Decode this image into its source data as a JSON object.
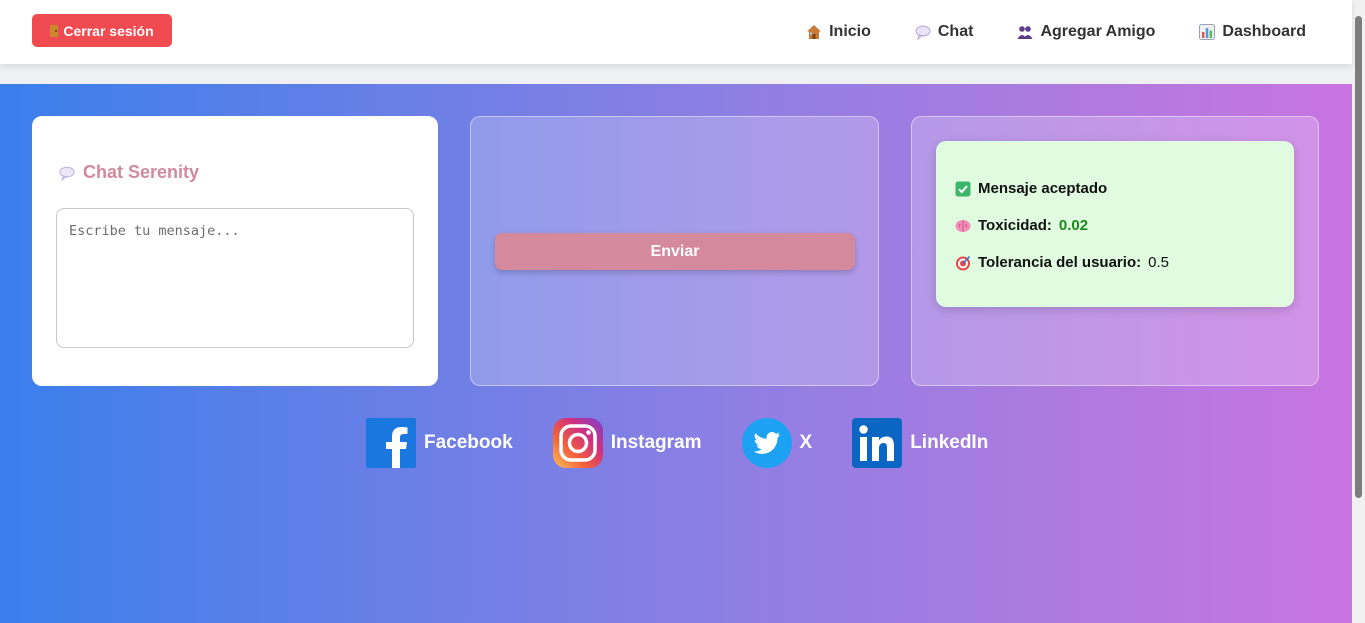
{
  "nav": {
    "logout_label": "Cerrar sesión",
    "links": [
      {
        "label": "Inicio",
        "icon": "house-icon"
      },
      {
        "label": "Chat",
        "icon": "speech-bubble-icon"
      },
      {
        "label": "Agregar Amigo",
        "icon": "people-icon"
      },
      {
        "label": "Dashboard",
        "icon": "bar-chart-icon"
      }
    ]
  },
  "chat": {
    "title": "Chat Serenity",
    "placeholder": "Escribe tu mensaje..."
  },
  "send": {
    "label": "Enviar"
  },
  "result": {
    "status": "Mensaje aceptado",
    "toxicity_label": "Toxicidad:",
    "toxicity_value": "0.02",
    "tolerance_label": "Tolerancia del usuario:",
    "tolerance_value": "0.5"
  },
  "socials": [
    {
      "label": "Facebook",
      "icon": "facebook-icon"
    },
    {
      "label": "Instagram",
      "icon": "instagram-icon"
    },
    {
      "label": "X",
      "icon": "twitter-icon"
    },
    {
      "label": "LinkedIn",
      "icon": "linkedin-icon"
    }
  ],
  "colors": {
    "logout_button": "#ef4b50",
    "accent_pink": "#d4899d",
    "result_bg": "#e0fbe0",
    "toxicity_value": "#1b8a1b",
    "gradient_start": "#3a7fec",
    "gradient_end": "#c874e0"
  }
}
